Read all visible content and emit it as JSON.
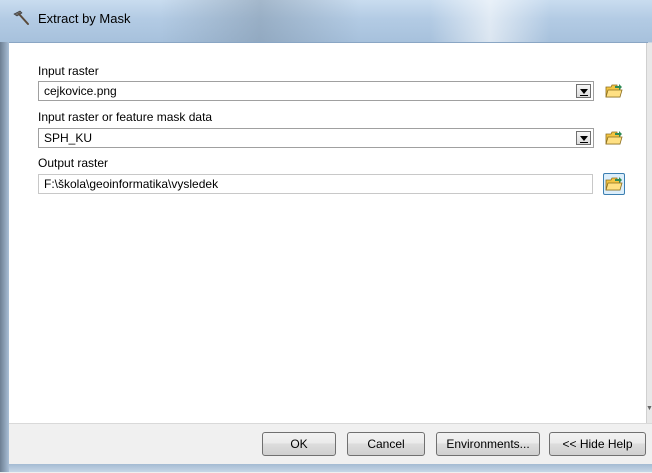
{
  "window": {
    "title": "Extract by Mask"
  },
  "fields": {
    "input_raster": {
      "label": "Input raster",
      "value": "cejkovice.png"
    },
    "mask_data": {
      "label": "Input raster or feature mask data",
      "value": "SPH_KU"
    },
    "output_raster": {
      "label": "Output raster",
      "value": "F:\\škola\\geoinformatika\\vysledek"
    }
  },
  "buttons": {
    "ok": "OK",
    "cancel": "Cancel",
    "environments": "Environments...",
    "hide_help": "<< Hide Help"
  },
  "icons": {
    "title": "hammer-tool-icon",
    "browse": "open-folder-icon"
  },
  "colors": {
    "titlebar": "#b3cbe4",
    "active_browse_border": "#3c7fb1",
    "folder_yellow": "#f4c542"
  }
}
